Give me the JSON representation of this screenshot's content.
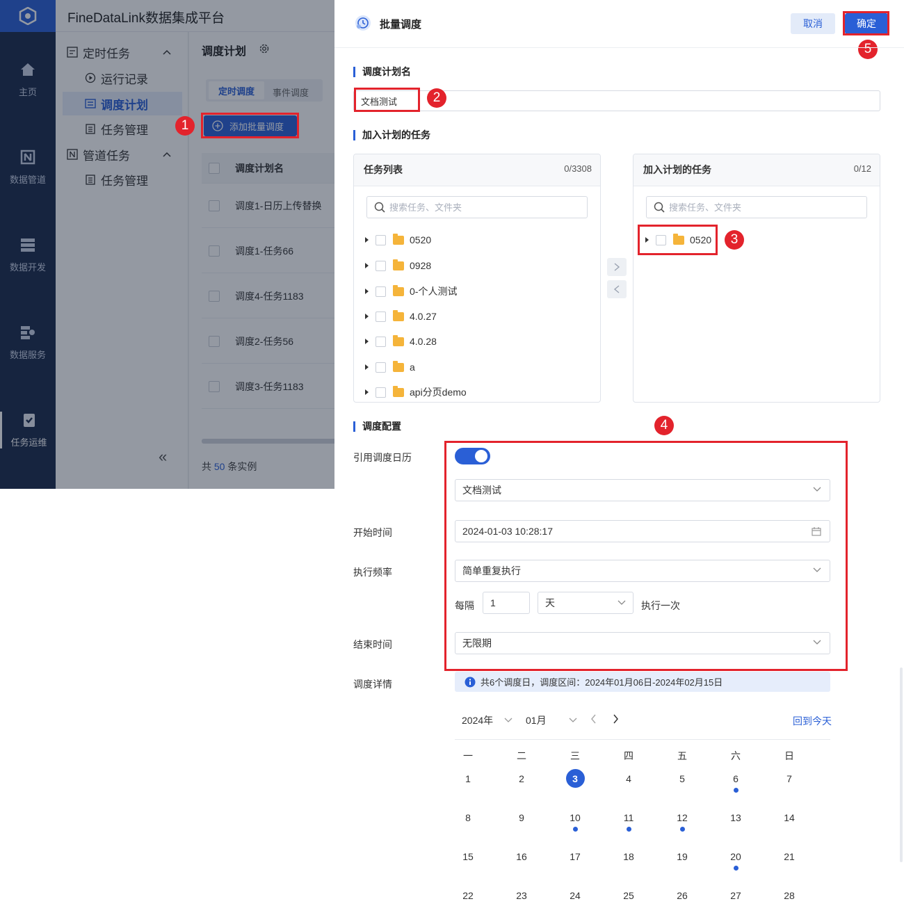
{
  "app": {
    "title": "FineDataLink数据集成平台",
    "nav": [
      {
        "label": "主页",
        "icon": "home-icon"
      },
      {
        "label": "数据管道",
        "icon": "pipeline-icon"
      },
      {
        "label": "数据开发",
        "icon": "dev-icon"
      },
      {
        "label": "数据服务",
        "icon": "service-icon"
      },
      {
        "label": "任务运维",
        "icon": "ops-icon"
      }
    ],
    "sidebar": {
      "groups": [
        {
          "label": "定时任务",
          "items": [
            "运行记录",
            "调度计划",
            "任务管理"
          ]
        },
        {
          "label": "管道任务",
          "items": [
            "任务管理"
          ]
        }
      ],
      "active_item": "调度计划",
      "collapse": "«"
    },
    "page_title": "调度计划",
    "tabs": [
      "定时调度",
      "事件调度"
    ],
    "add_button": "添加批量调度",
    "table": {
      "header": "调度计划名",
      "rows": [
        "调度1-日历上传替换",
        "调度1-任务66",
        "调度4-任务1183",
        "调度2-任务56",
        "调度3-任务1183"
      ]
    },
    "footer": {
      "prefix": "共",
      "count": "50",
      "suffix": "条实例"
    }
  },
  "drawer": {
    "title": "批量调度",
    "cancel": "取消",
    "confirm": "确定",
    "plan_name_label": "调度计划名",
    "plan_name_value": "文档测试",
    "tasks_label": "加入计划的任务",
    "left_panel": {
      "title": "任务列表",
      "count": "0/3308",
      "search_placeholder": "搜索任务、文件夹",
      "items": [
        "0520",
        "0928",
        "0-个人测试",
        "4.0.27",
        "4.0.28",
        "a",
        "api分页demo"
      ]
    },
    "right_panel": {
      "title": "加入计划的任务",
      "count": "0/12",
      "search_placeholder": "搜索任务、文件夹",
      "items": [
        "0520"
      ]
    },
    "config_label": "调度配置",
    "use_calendar_label": "引用调度日历",
    "use_calendar_on": true,
    "calendar_select": "文档测试",
    "start_time_label": "开始时间",
    "start_time": "2024-01-03 10:28:17",
    "frequency_label": "执行频率",
    "frequency": "简单重复执行",
    "every_label": "每隔",
    "every_value": "1",
    "unit": "天",
    "once_label": "执行一次",
    "end_time_label": "结束时间",
    "end_time": "无限期",
    "detail_label": "调度详情",
    "detail_info": "共6个调度日，调度区间：2024年01月06日-2024年02月15日",
    "calendar": {
      "year": "2024年",
      "month": "01月",
      "today_link": "回到今天",
      "weekdays": [
        "一",
        "二",
        "三",
        "四",
        "五",
        "六",
        "日"
      ],
      "weeks": [
        [
          "1",
          "2",
          "3",
          "4",
          "5",
          "6",
          "7"
        ],
        [
          "8",
          "9",
          "10",
          "11",
          "12",
          "13",
          "14"
        ],
        [
          "15",
          "16",
          "17",
          "18",
          "19",
          "20",
          "21"
        ],
        [
          "22",
          "23",
          "24",
          "25",
          "26",
          "27",
          "28"
        ]
      ],
      "today": "3",
      "scheduled_days": [
        "6",
        "10",
        "11",
        "12",
        "20"
      ]
    }
  },
  "annotations": [
    "1",
    "2",
    "3",
    "4",
    "5"
  ],
  "colors": {
    "accent": "#2a5fd6",
    "highlight": "#e3232c",
    "nav_bg": "#1a2a4c"
  }
}
